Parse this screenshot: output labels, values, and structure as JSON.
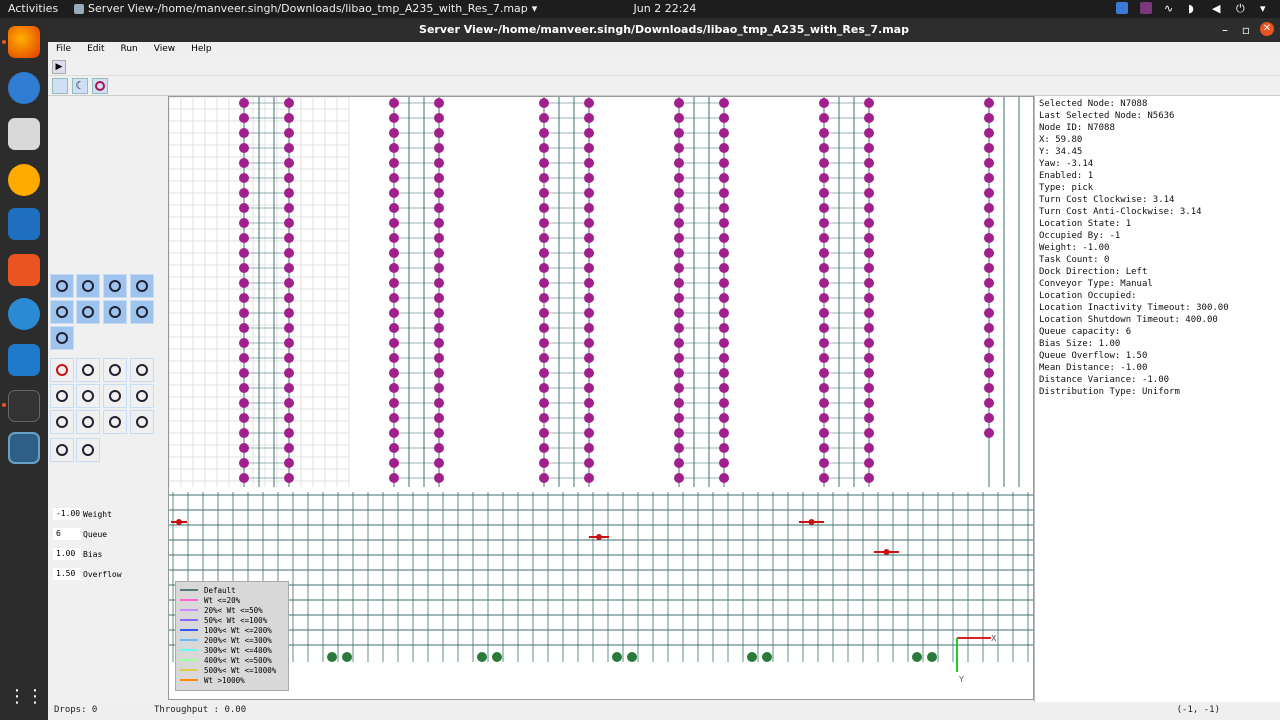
{
  "topbar": {
    "activities": "Activities",
    "app_title": "Server View-/home/manveer.singh/Downloads/libao_tmp_A235_with_Res_7.map",
    "clock": "Jun 2  22:24"
  },
  "window": {
    "title": "Server View-/home/manveer.singh/Downloads/libao_tmp_A235_with_Res_7.map"
  },
  "menu": [
    "File",
    "Edit",
    "Run",
    "View",
    "Help"
  ],
  "properties": [
    {
      "value": "-1.00",
      "label": "Weight"
    },
    {
      "value": "6",
      "label": "Queue"
    },
    {
      "value": "1.00",
      "label": "Bias"
    },
    {
      "value": "1.50",
      "label": "Overflow"
    }
  ],
  "info_panel": [
    "Selected Node: N7088",
    "Last Selected Node: N5636",
    " Node ID: N7088",
    " X: 59.80",
    " Y: 34.45",
    " Yaw: -3.14",
    " Enabled: 1",
    " Type: pick",
    " Turn Cost Clockwise: 3.14",
    " Turn Cost Anti-Clockwise: 3.14",
    " Location State: 1",
    " Occupied By: -1",
    " Weight: -1.00",
    " Task Count: 0",
    " Dock Direction: Left",
    " Conveyor Type: Manual",
    " Location Occupied:",
    " Location Inactivity Timeout: 300.00",
    " Location Shutdown Timeout: 400.00",
    " Queue capacity: 6",
    " Bias Size: 1.00",
    " Queue Overflow: 1.50",
    " Mean Distance: -1.00",
    " Distance Variance: -1.00",
    " Distribution Type: Uniform"
  ],
  "legend": [
    {
      "label": "Default",
      "color": "#557a7a"
    },
    {
      "label": "Wt <=20%",
      "color": "#ff66cc"
    },
    {
      "label": "20%< Wt <=50%",
      "color": "#cc88ff"
    },
    {
      "label": "50%< Wt <=100%",
      "color": "#8866ff"
    },
    {
      "label": "100%< Wt <=200%",
      "color": "#3355ff"
    },
    {
      "label": "200%< Wt <=300%",
      "color": "#66bbff"
    },
    {
      "label": "300%< Wt <=400%",
      "color": "#66ffee"
    },
    {
      "label": "400%< Wt <=500%",
      "color": "#99ff99"
    },
    {
      "label": "500%< Wt <=1000%",
      "color": "#ddcc44"
    },
    {
      "label": "Wt >1000%",
      "color": "#ff8800"
    }
  ],
  "status": {
    "drops": "Drops: 0",
    "throughput": "Throughput : 0.00",
    "coords": "(-1, -1)"
  },
  "axis": {
    "x": "X",
    "y": "Y"
  },
  "colors": {
    "node_magenta": "#a0208c",
    "node_green": "#2a7a3a",
    "edge": "#3f6f6f",
    "highlight_red": "#cc1111",
    "tool_blue": "#9ec3ef"
  }
}
